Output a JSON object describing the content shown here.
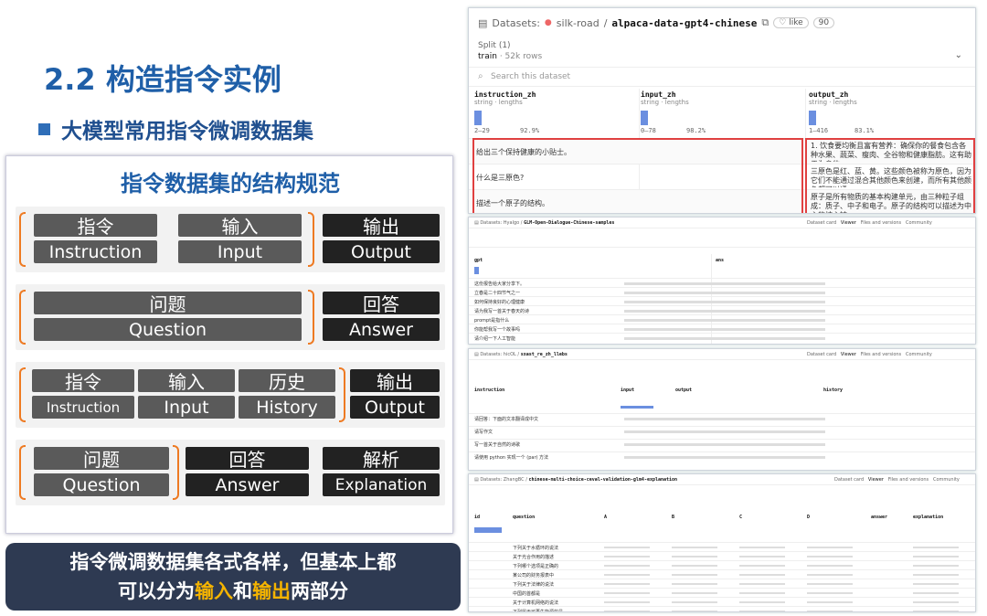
{
  "title": "2.2 构造指令实例",
  "subtitle": "大模型常用指令微调数据集",
  "panel": {
    "title": "指令数据集的结构规范",
    "g1": {
      "a_zh": "指令",
      "a_en": "Instruction",
      "b_zh": "输入",
      "b_en": "Input",
      "c_zh": "输出",
      "c_en": "Output"
    },
    "g2": {
      "a_zh": "问题",
      "a_en": "Question",
      "c_zh": "回答",
      "c_en": "Answer"
    },
    "g3": {
      "a_zh": "指令",
      "a_en": "Instruction",
      "b_zh": "输入",
      "b_en": "Input",
      "h_zh": "历史",
      "h_en": "History",
      "c_zh": "输出",
      "c_en": "Output"
    },
    "g4": {
      "a_zh": "问题",
      "a_en": "Question",
      "b_zh": "回答",
      "b_en": "Answer",
      "c_zh": "解析",
      "c_en": "Explanation"
    }
  },
  "callout": {
    "line1": "指令微调数据集各式各样，但基本上都",
    "line2_pre": "可以分为",
    "in": "输入",
    "and": "和",
    "out": "输出",
    "line2_post": "两部分"
  },
  "shot1": {
    "datasets": "Datasets:",
    "user": "silk-road",
    "slash": "/",
    "name": "alpaca-data-gpt4-chinese",
    "like": "like",
    "likes": "90",
    "split_label": "Split (1)",
    "split": "train",
    "rows": "· 52k rows",
    "search": "Search this dataset",
    "cols": [
      {
        "name": "instruction_zh",
        "type": "string · lengths",
        "range": "2–29",
        "pct": "92.9%"
      },
      {
        "name": "input_zh",
        "type": "string · lengths",
        "range": "0–78",
        "pct": "98.2%"
      },
      {
        "name": "output_zh",
        "type": "string · lengths",
        "range": "1–416",
        "pct": "83.1%"
      }
    ],
    "rows_data": [
      {
        "a": "给出三个保持健康的小贴士。",
        "c": "1. 饮食要均衡且富有营养：确保你的餐食包含各种水果、蔬菜、瘦肉、全谷物和健康脂肪。这有助于为身体…"
      },
      {
        "a": "什么是三原色?",
        "c": "三原色是红、蓝、黄。这些颜色被称为原色，因为它们不能通过混合其他颜色来创建，而所有其他颜色都可以通…"
      },
      {
        "a": "描述一个原子的结构。",
        "c": "原子是所有物质的基本构建单元，由三种粒子组成：质子、中子和电子。原子的结构可以描述为中心的核心被…"
      }
    ]
  },
  "shot2": {
    "datasets": "Datasets:",
    "user": "Hyalgo",
    "name": "GLM-Open-Dialogue-Chinese-samples",
    "dataset_card": "Dataset card",
    "viewer": "Viewer",
    "files": "Files and versions",
    "community": "Community",
    "cols": [
      "gpt",
      "ans"
    ],
    "rows": [
      "这份报告给大家分享下。",
      "立春是二十四节气之一",
      "如何保持良好的心理健康",
      "请为我写一首关于春天的诗",
      "prompt是指什么",
      "你能帮我写一个故事吗",
      "请介绍一下人工智能"
    ]
  },
  "shot3": {
    "datasets": "Datasets:",
    "user": "hicOL",
    "name": "sxast_re_zh_llebs",
    "dataset_card": "Dataset card",
    "viewer": "Viewer",
    "files": "Files and versions",
    "community": "Community",
    "cols": [
      "instruction",
      "input",
      "output",
      "history"
    ],
    "rows": [
      "请回答：下面的文本翻译成中文",
      "请写作文",
      "写一首关于自然的诗歌",
      "请使用 python 实现一个 (par) 方法"
    ]
  },
  "shot4": {
    "datasets": "Datasets:",
    "user": "ZhangBC",
    "name": "chinese-multi-choice-ceval-validation-glm4-explanation",
    "dataset_card": "Dataset card",
    "viewer": "Viewer",
    "files": "Files and versions",
    "community": "Community",
    "cols": [
      "id",
      "question",
      "A",
      "B",
      "C",
      "D",
      "answer",
      "explanation"
    ],
    "rows": [
      "下列关于水循环的说法",
      "关于光合作用的描述",
      "下列哪个选项是正确的",
      "某公司的财务报表中",
      "下列关于法律的说法",
      "中国的首都是",
      "关于计算机网络的说法",
      "下列属于可再生能源的是"
    ]
  }
}
